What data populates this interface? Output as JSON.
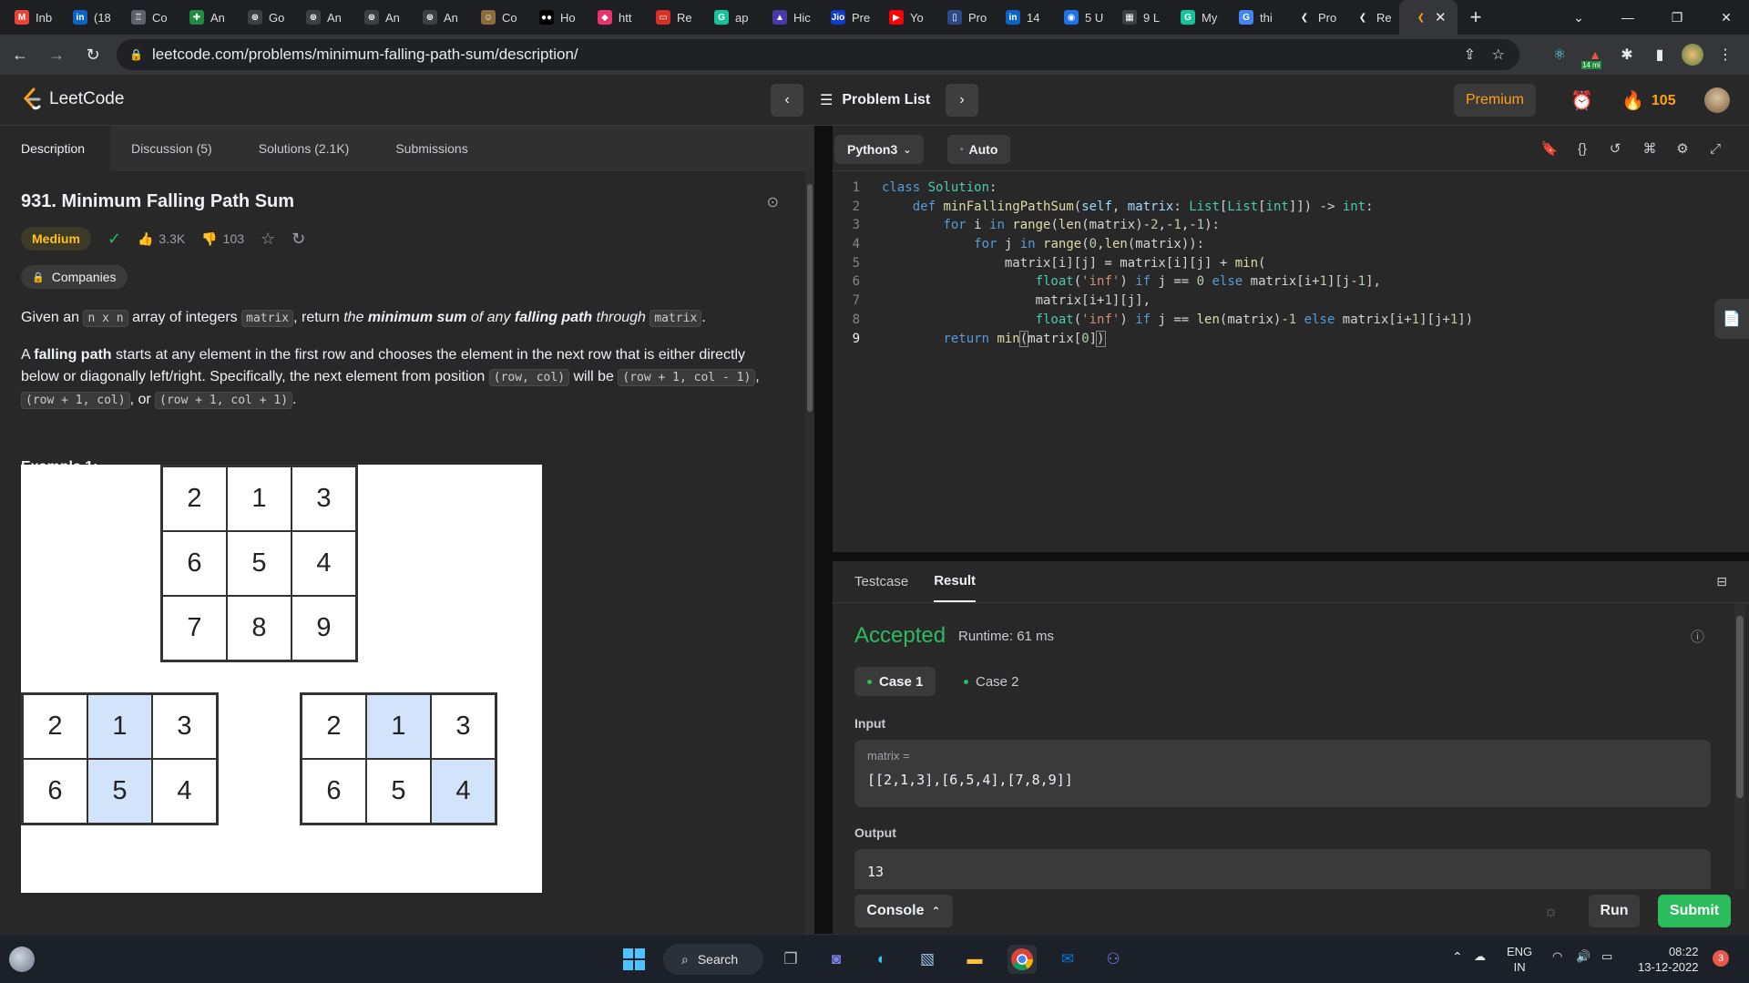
{
  "browser": {
    "tabs": [
      {
        "title": "Inb",
        "icon": "gmail-icon",
        "color": "#ea4335",
        "glyph": "M"
      },
      {
        "title": "(18",
        "icon": "linkedin-icon",
        "color": "#0a66c2",
        "glyph": "in"
      },
      {
        "title": "Co",
        "icon": "coder-icon",
        "color": "#5f6368",
        "glyph": "♖"
      },
      {
        "title": "An",
        "icon": "plus-icon",
        "color": "#1e8e3e",
        "glyph": "✚"
      },
      {
        "title": "Go",
        "icon": "chatgpt-icon",
        "color": "#3c4043",
        "glyph": "⊛"
      },
      {
        "title": "An",
        "icon": "chatgpt-icon",
        "color": "#3c4043",
        "glyph": "⊛"
      },
      {
        "title": "An",
        "icon": "chatgpt-icon",
        "color": "#3c4043",
        "glyph": "⊛"
      },
      {
        "title": "An",
        "icon": "chatgpt-icon",
        "color": "#3c4043",
        "glyph": "⊛"
      },
      {
        "title": "Co",
        "icon": "coder-avatar-icon",
        "color": "#8e6c3a",
        "glyph": "☺"
      },
      {
        "title": "Ho",
        "icon": "medium-icon",
        "color": "#000000",
        "glyph": "●●"
      },
      {
        "title": "htt",
        "icon": "bookmark-pink-icon",
        "color": "#e8336d",
        "glyph": "◆"
      },
      {
        "title": "Re",
        "icon": "opera-icon",
        "color": "#d93025",
        "glyph": "▭"
      },
      {
        "title": "ap",
        "icon": "grammarly-icon",
        "color": "#15c39a",
        "glyph": "G"
      },
      {
        "title": "Hic",
        "icon": "triangle-icon",
        "color": "#4a3aa8",
        "glyph": "▲"
      },
      {
        "title": "Pre",
        "icon": "jio-icon",
        "color": "#0f3cc9",
        "glyph": "Jio"
      },
      {
        "title": "Yo",
        "icon": "youtube-icon",
        "color": "#ff0000",
        "glyph": "▶"
      },
      {
        "title": "Pro",
        "icon": "book-icon",
        "color": "#2b4a8a",
        "glyph": "▯"
      },
      {
        "title": "14",
        "icon": "linkedin-icon",
        "color": "#0a66c2",
        "glyph": "in"
      },
      {
        "title": "5 U",
        "icon": "shield-blue-icon",
        "color": "#1a73e8",
        "glyph": "◉"
      },
      {
        "title": "9 L",
        "icon": "calendar-icon",
        "color": "#3c4043",
        "glyph": "▦"
      },
      {
        "title": "My",
        "icon": "grammarly-icon",
        "color": "#15c39a",
        "glyph": "G"
      },
      {
        "title": "thi",
        "icon": "google-icon",
        "color": "#4285f4",
        "glyph": "G"
      },
      {
        "title": "Pro",
        "icon": "leetcode-icon",
        "color": "#1e1f22",
        "glyph": "❮"
      },
      {
        "title": "Re",
        "icon": "leetcode-icon",
        "color": "#1e1f22",
        "glyph": "❮"
      }
    ],
    "active_tab_icon": "leetcode-icon",
    "url": "leetcode.com/problems/minimum-falling-path-sum/description/",
    "ext_badge": "14 mi"
  },
  "nav": {
    "logo_text": "LeetCode",
    "problem_list": "Problem List",
    "premium": "Premium",
    "streak": "105"
  },
  "left_tabs": [
    "Description",
    "Discussion (5)",
    "Solutions (2.1K)",
    "Submissions"
  ],
  "problem": {
    "title": "931. Minimum Falling Path Sum",
    "difficulty": "Medium",
    "likes": "3.3K",
    "dislikes": "103",
    "companies": "Companies",
    "desc": {
      "t1": "Given an ",
      "c1": "n x n",
      "t2": " array of integers ",
      "c2": "matrix",
      "t3": ", return ",
      "e1": "the ",
      "b1": "minimum sum",
      "e2": " of any ",
      "b2": "falling path",
      "e3": " through ",
      "c3": "matrix",
      "t4": "."
    },
    "fp": {
      "t1": "A ",
      "b1": "falling path",
      "t2": " starts at any element in the first row and chooses the element in the next row that is either directly below or diagonally left/right. Specifically, the next element from position ",
      "c1": "(row, col)",
      "t3": " will be ",
      "c2": "(row + 1, col - 1)",
      "t4": ", ",
      "c3": "(row + 1, col)",
      "t5": ", or ",
      "c4": "(row + 1, col + 1)",
      "t6": "."
    },
    "example_label": "Example 1:",
    "grid_main": [
      "2",
      "1",
      "3",
      "6",
      "5",
      "4",
      "7",
      "8",
      "9"
    ],
    "grid_a": [
      "2",
      "1",
      "3",
      "6",
      "5",
      "4"
    ],
    "grid_b": [
      "2",
      "1",
      "3",
      "6",
      "5",
      "4"
    ]
  },
  "editor": {
    "language": "Python3",
    "mode": "Auto",
    "line_numbers": [
      "1",
      "2",
      "3",
      "4",
      "5",
      "6",
      "7",
      "8",
      "9"
    ]
  },
  "result": {
    "tabs": [
      "Testcase",
      "Result"
    ],
    "status": "Accepted",
    "runtime": "Runtime: 61 ms",
    "cases": [
      "Case 1",
      "Case 2"
    ],
    "input_label": "Input",
    "input_var": "matrix =",
    "input_value": "[[2,1,3],[6,5,4],[7,8,9]]",
    "output_label": "Output",
    "output_value": "13",
    "console": "Console",
    "run": "Run",
    "submit": "Submit"
  },
  "taskbar": {
    "search": "Search",
    "lang_top": "ENG",
    "lang_bottom": "IN",
    "time": "08:22",
    "date": "13-12-2022",
    "notif": "3"
  }
}
